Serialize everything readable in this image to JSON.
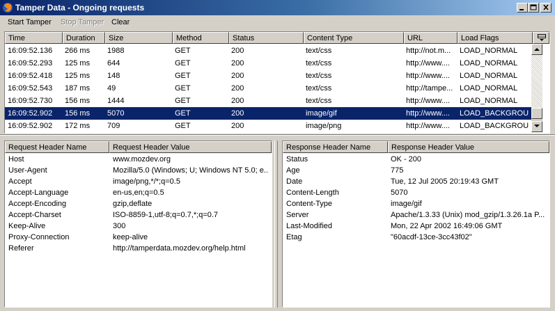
{
  "window": {
    "title": "Tamper Data - Ongoing requests",
    "icon": "firefox-icon"
  },
  "menu": {
    "start_tamper": "Start Tamper",
    "stop_tamper": "Stop Tamper",
    "clear": "Clear"
  },
  "requests": {
    "columns": [
      "Time",
      "Duration",
      "Size",
      "Method",
      "Status",
      "Content Type",
      "URL",
      "Load Flags"
    ],
    "rows": [
      [
        "16:09:52.136",
        "266 ms",
        "1988",
        "GET",
        "200",
        "text/css",
        "http://not.m...",
        "LOAD_NORMAL"
      ],
      [
        "16:09:52.293",
        "125 ms",
        "644",
        "GET",
        "200",
        "text/css",
        "http://www....",
        "LOAD_NORMAL"
      ],
      [
        "16:09:52.418",
        "125 ms",
        "148",
        "GET",
        "200",
        "text/css",
        "http://www....",
        "LOAD_NORMAL"
      ],
      [
        "16:09:52.543",
        "187 ms",
        "49",
        "GET",
        "200",
        "text/css",
        "http://tampe...",
        "LOAD_NORMAL"
      ],
      [
        "16:09:52.730",
        "156 ms",
        "1444",
        "GET",
        "200",
        "text/css",
        "http://www....",
        "LOAD_NORMAL"
      ],
      [
        "16:09:52.902",
        "156 ms",
        "5070",
        "GET",
        "200",
        "image/gif",
        "http://www....",
        "LOAD_BACKGROU..."
      ],
      [
        "16:09:52.902",
        "172 ms",
        "709",
        "GET",
        "200",
        "image/png",
        "http://www....",
        "LOAD_BACKGROU..."
      ]
    ],
    "selected_index": 5
  },
  "request_headers": {
    "columns": [
      "Request Header Name",
      "Request Header Value"
    ],
    "rows": [
      [
        "Host",
        "www.mozdev.org"
      ],
      [
        "User-Agent",
        "Mozilla/5.0 (Windows; U; Windows NT 5.0; e..."
      ],
      [
        "Accept",
        "image/png,*/*;q=0.5"
      ],
      [
        "Accept-Language",
        "en-us,en;q=0.5"
      ],
      [
        "Accept-Encoding",
        "gzip,deflate"
      ],
      [
        "Accept-Charset",
        "ISO-8859-1,utf-8;q=0.7,*;q=0.7"
      ],
      [
        "Keep-Alive",
        "300"
      ],
      [
        "Proxy-Connection",
        "keep-alive"
      ],
      [
        "Referer",
        "http://tamperdata.mozdev.org/help.html"
      ]
    ]
  },
  "response_headers": {
    "columns": [
      "Response Header Name",
      "Response Header Value"
    ],
    "rows": [
      [
        "Status",
        "OK - 200"
      ],
      [
        "Age",
        "775"
      ],
      [
        "Date",
        "Tue, 12 Jul 2005 20:19:43 GMT"
      ],
      [
        "Content-Length",
        "5070"
      ],
      [
        "Content-Type",
        "image/gif"
      ],
      [
        "Server",
        "Apache/1.3.33 (Unix) mod_gzip/1.3.26.1a P..."
      ],
      [
        "Last-Modified",
        "Mon, 22 Apr 2002 16:49:06 GMT"
      ],
      [
        "Etag",
        "\"60acdf-13ce-3cc43f02\""
      ]
    ]
  },
  "colors": {
    "selection": "#0a246a",
    "titlebar_start": "#0a246a",
    "titlebar_end": "#a6caf0",
    "chrome": "#d4d0c8"
  }
}
